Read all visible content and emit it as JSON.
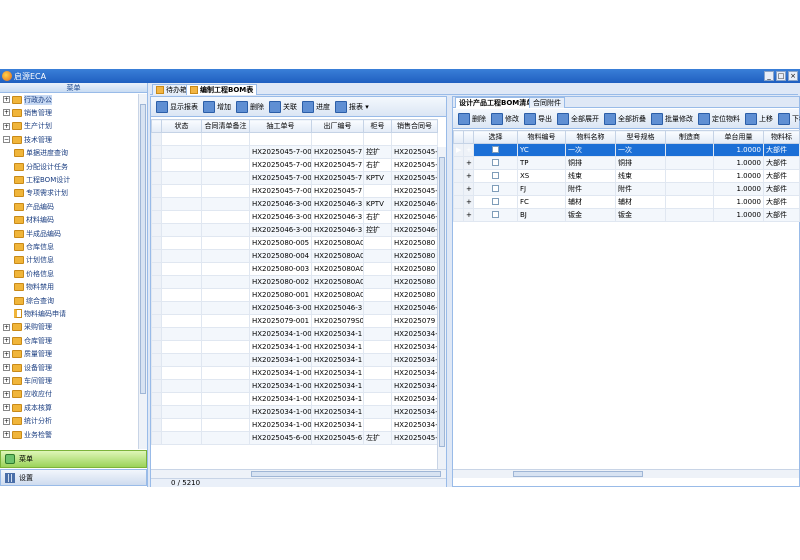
{
  "window": {
    "title": "启源ECA"
  },
  "sidebar": {
    "header": "菜单",
    "items": [
      {
        "label": "行政办公",
        "level": 0,
        "kind": "folder",
        "expanded": false,
        "selected": true
      },
      {
        "label": "销售管理",
        "level": 0,
        "kind": "folder",
        "expanded": false
      },
      {
        "label": "生产计划",
        "level": 0,
        "kind": "folder",
        "expanded": false
      },
      {
        "label": "技术管理",
        "level": 0,
        "kind": "folder",
        "expanded": true
      },
      {
        "label": "单据进度查询",
        "level": 1,
        "kind": "folder"
      },
      {
        "label": "分配设计任务",
        "level": 1,
        "kind": "folder"
      },
      {
        "label": "工程BOM设计",
        "level": 1,
        "kind": "folder"
      },
      {
        "label": "专项需求计划",
        "level": 1,
        "kind": "folder"
      },
      {
        "label": "产品编码",
        "level": 1,
        "kind": "folder"
      },
      {
        "label": "材料编码",
        "level": 1,
        "kind": "folder"
      },
      {
        "label": "半成品编码",
        "level": 1,
        "kind": "folder"
      },
      {
        "label": "仓库信息",
        "level": 1,
        "kind": "folder"
      },
      {
        "label": "计划信息",
        "level": 1,
        "kind": "folder"
      },
      {
        "label": "价格信息",
        "level": 1,
        "kind": "folder"
      },
      {
        "label": "物料禁用",
        "level": 1,
        "kind": "folder"
      },
      {
        "label": "综合查询",
        "level": 1,
        "kind": "folder"
      },
      {
        "label": "物料编码申请",
        "level": 1,
        "kind": "doc"
      },
      {
        "label": "采购管理",
        "level": 0,
        "kind": "folder",
        "expanded": false
      },
      {
        "label": "仓库管理",
        "level": 0,
        "kind": "folder",
        "expanded": false
      },
      {
        "label": "质量管理",
        "level": 0,
        "kind": "folder",
        "expanded": false
      },
      {
        "label": "设备管理",
        "level": 0,
        "kind": "folder",
        "expanded": false
      },
      {
        "label": "车间管理",
        "level": 0,
        "kind": "folder",
        "expanded": false
      },
      {
        "label": "应收应付",
        "level": 0,
        "kind": "folder",
        "expanded": false
      },
      {
        "label": "成本核算",
        "level": 0,
        "kind": "folder",
        "expanded": false
      },
      {
        "label": "统计分析",
        "level": 0,
        "kind": "folder",
        "expanded": false
      },
      {
        "label": "业务检警",
        "level": 0,
        "kind": "folder",
        "expanded": false
      }
    ],
    "accordion": [
      {
        "label": "菜单"
      },
      {
        "label": "设置"
      }
    ]
  },
  "tabs": [
    {
      "label": "待办箱"
    },
    {
      "label": "编制工程BOM表"
    }
  ],
  "left": {
    "toolbar": [
      "显示报表",
      "增加",
      "删除",
      "关联",
      "进度",
      "报表 ▾"
    ],
    "columns": [
      "状态",
      "合同清单备注",
      "抽工单号",
      "出厂编号",
      "柜号",
      "销售合同号"
    ],
    "rows": [
      [
        "",
        "",
        "HX2025045-7-001...",
        "HX2025045-7...",
        "控扩",
        "HX2025045-7"
      ],
      [
        "",
        "",
        "HX2025045-7-001...",
        "HX2025045-7...",
        "右扩",
        "HX2025045-7"
      ],
      [
        "",
        "",
        "HX2025045-7-001...",
        "HX2025045-7...",
        "KPTV",
        "HX2025045-7"
      ],
      [
        "",
        "",
        "HX2025045-7-001",
        "HX2025045-7...",
        "",
        "HX2025045-7"
      ],
      [
        "",
        "",
        "HX2025046-3-001...",
        "HX2025046-3...",
        "KPTV",
        "HX2025046-3"
      ],
      [
        "",
        "",
        "HX2025046-3-001...",
        "HX2025046-3...",
        "右扩",
        "HX2025046-3"
      ],
      [
        "",
        "",
        "HX2025046-3-001...",
        "HX2025046-3...",
        "控扩",
        "HX2025046-3"
      ],
      [
        "",
        "",
        "HX2025080-005",
        "HX2025080A0...",
        "",
        "HX2025080"
      ],
      [
        "",
        "",
        "HX2025080-004",
        "HX2025080A0...",
        "",
        "HX2025080"
      ],
      [
        "",
        "",
        "HX2025080-003",
        "HX2025080A0...",
        "",
        "HX2025080"
      ],
      [
        "",
        "",
        "HX2025080-002",
        "HX2025080A0...",
        "",
        "HX2025080"
      ],
      [
        "",
        "",
        "HX2025080-001",
        "HX2025080A0...",
        "",
        "HX2025080"
      ],
      [
        "",
        "",
        "HX2025046-3-001",
        "HX2025046-3...",
        "",
        "HX2025046-3"
      ],
      [
        "",
        "",
        "HX2025079-001",
        "HX2025079S0...",
        "",
        "HX2025079"
      ],
      [
        "",
        "",
        "HX2025034-1-008",
        "HX2025034-1...",
        "",
        "HX2025034-1"
      ],
      [
        "",
        "",
        "HX2025034-1-007",
        "HX2025034-1...",
        "",
        "HX2025034-1"
      ],
      [
        "",
        "",
        "HX2025034-1-006",
        "HX2025034-1...",
        "",
        "HX2025034-1"
      ],
      [
        "",
        "",
        "HX2025034-1-005",
        "HX2025034-1...",
        "",
        "HX2025034-1"
      ],
      [
        "",
        "",
        "HX2025034-1-004",
        "HX2025034-1...",
        "",
        "HX2025034-1"
      ],
      [
        "",
        "",
        "HX2025034-1-003",
        "HX2025034-1...",
        "",
        "HX2025034-1"
      ],
      [
        "",
        "",
        "HX2025034-1-002",
        "HX2025034-1...",
        "",
        "HX2025034-1"
      ],
      [
        "",
        "",
        "HX2025034-1-001",
        "HX2025034-1...",
        "",
        "HX2025034-1"
      ],
      [
        "",
        "",
        "HX2025045-6-001...",
        "HX2025045-6...",
        "左扩",
        "HX2025045-6"
      ]
    ],
    "status": "0 / 5210"
  },
  "right": {
    "subtabs": [
      {
        "label": "设计产品工程BOM清单"
      },
      {
        "label": "合同附件"
      }
    ],
    "toolbar": [
      "删除",
      "修改",
      "导出",
      "全部展开",
      "全部折叠",
      "批量修改",
      "定位物料",
      "上移",
      "下移"
    ],
    "columns": [
      "选择",
      "物料编号",
      "物料名称",
      "型号规格",
      "制造商",
      "单台用量",
      "物料标"
    ],
    "rows": [
      [
        "",
        "YC",
        "一次",
        "一次",
        "",
        "1.0000",
        "大部件"
      ],
      [
        "",
        "TP",
        "铜排",
        "铜排",
        "",
        "1.0000",
        "大部件"
      ],
      [
        "",
        "XS",
        "线束",
        "线束",
        "",
        "1.0000",
        "大部件"
      ],
      [
        "",
        "FJ",
        "附件",
        "附件",
        "",
        "1.0000",
        "大部件"
      ],
      [
        "",
        "FC",
        "辅材",
        "辅材",
        "",
        "1.0000",
        "大部件"
      ],
      [
        "",
        "BJ",
        "钣金",
        "钣金",
        "",
        "1.0000",
        "大部件"
      ]
    ]
  },
  "colors": {
    "accent": "#1b6fd6",
    "titlebar": "#1f5fc0",
    "selected_row": "#1b6fd6"
  }
}
